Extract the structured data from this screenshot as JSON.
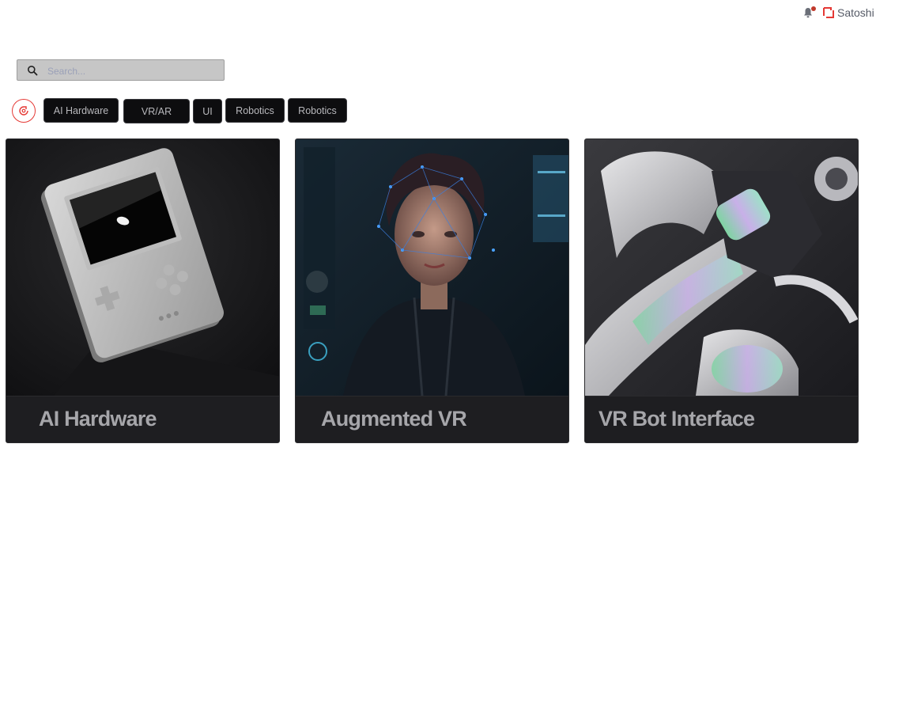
{
  "header": {
    "user_name": "Satoshi",
    "notification_indicator": true
  },
  "search": {
    "placeholder": "Search...",
    "value": ""
  },
  "filters": [
    {
      "label": "AI Hardware"
    },
    {
      "label": "VR/AR"
    },
    {
      "label": "UI"
    },
    {
      "label": "Robotics"
    },
    {
      "label": "Robotics"
    }
  ],
  "cards": [
    {
      "title": "AI Hardware",
      "image": "white-retro-handheld-console"
    },
    {
      "title": "Augmented VR",
      "image": "woman-with-holographic-interface"
    },
    {
      "title": "VR Bot Interface",
      "image": "iridescent-robotic-arm"
    }
  ],
  "colors": {
    "brand_red": "#e53935",
    "chip_bg": "#0d0d0f",
    "card_bg": "#1c1c1f",
    "card_title": "#a6a6aa"
  }
}
